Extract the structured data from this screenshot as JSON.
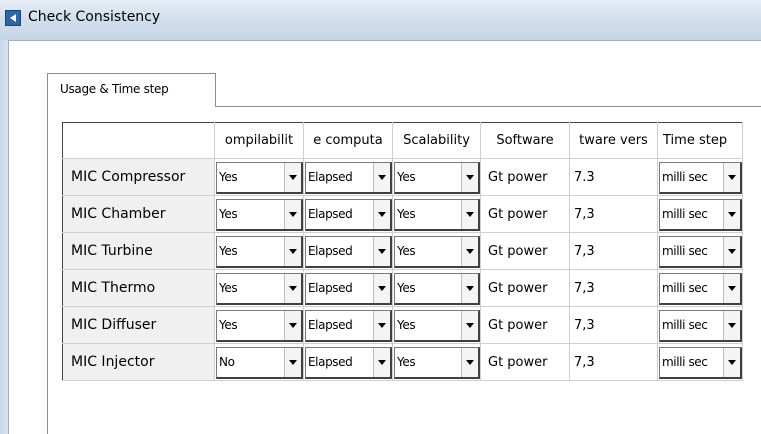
{
  "window": {
    "title": "Check Consistency"
  },
  "tabs": [
    {
      "label": "Usage & Time step"
    }
  ],
  "table": {
    "columns": [
      "",
      "ompilabilit",
      "e computa",
      "Scalability",
      "Software",
      "tware vers",
      "Time step"
    ],
    "rows": [
      {
        "label": "MIC Compressor",
        "compilability": "Yes",
        "computation": "Elapsed",
        "scalability": "Yes",
        "software": "Gt power",
        "version": "7.3",
        "time_step": "milli sec"
      },
      {
        "label": "MIC Chamber",
        "compilability": "Yes",
        "computation": "Elapsed",
        "scalability": "Yes",
        "software": "Gt power",
        "version": "7,3",
        "time_step": "milli sec"
      },
      {
        "label": "MIC Turbine",
        "compilability": "Yes",
        "computation": "Elapsed",
        "scalability": "Yes",
        "software": "Gt power",
        "version": "7,3",
        "time_step": "milli sec"
      },
      {
        "label": "MIC Thermo",
        "compilability": "Yes",
        "computation": "Elapsed",
        "scalability": "Yes",
        "software": "Gt power",
        "version": "7,3",
        "time_step": "milli sec"
      },
      {
        "label": "MIC Diffuser",
        "compilability": "Yes",
        "computation": "Elapsed",
        "scalability": "Yes",
        "software": "Gt power",
        "version": "7,3",
        "time_step": "milli sec"
      },
      {
        "label": "MIC Injector",
        "compilability": "No",
        "computation": "Elapsed",
        "scalability": "Yes",
        "software": "Gt power",
        "version": "7,3",
        "time_step": "milli sec"
      }
    ]
  },
  "icons": {
    "window": "app-icon",
    "dropdown": "chevron-down-icon"
  },
  "colors": {
    "titlebar": "#d3dfec",
    "rowheader": "#f0f0f0",
    "grid_border": "#444444"
  }
}
